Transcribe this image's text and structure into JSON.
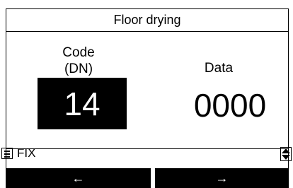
{
  "header": {
    "title": "Floor drying"
  },
  "code": {
    "label_line1": "Code",
    "label_line2": "(DN)",
    "value": "14"
  },
  "data": {
    "label": "Data",
    "value": "0000"
  },
  "footer": {
    "menu_icon": "menu-list-icon",
    "fix_label": "FIX",
    "scroll_icon": "up-down-scroll-icon"
  },
  "buttons": {
    "left_label": "←",
    "right_label": "→"
  },
  "colors": {
    "background": "#ffffff",
    "foreground": "#000000",
    "highlight_bg": "#000000",
    "highlight_fg": "#ffffff"
  }
}
